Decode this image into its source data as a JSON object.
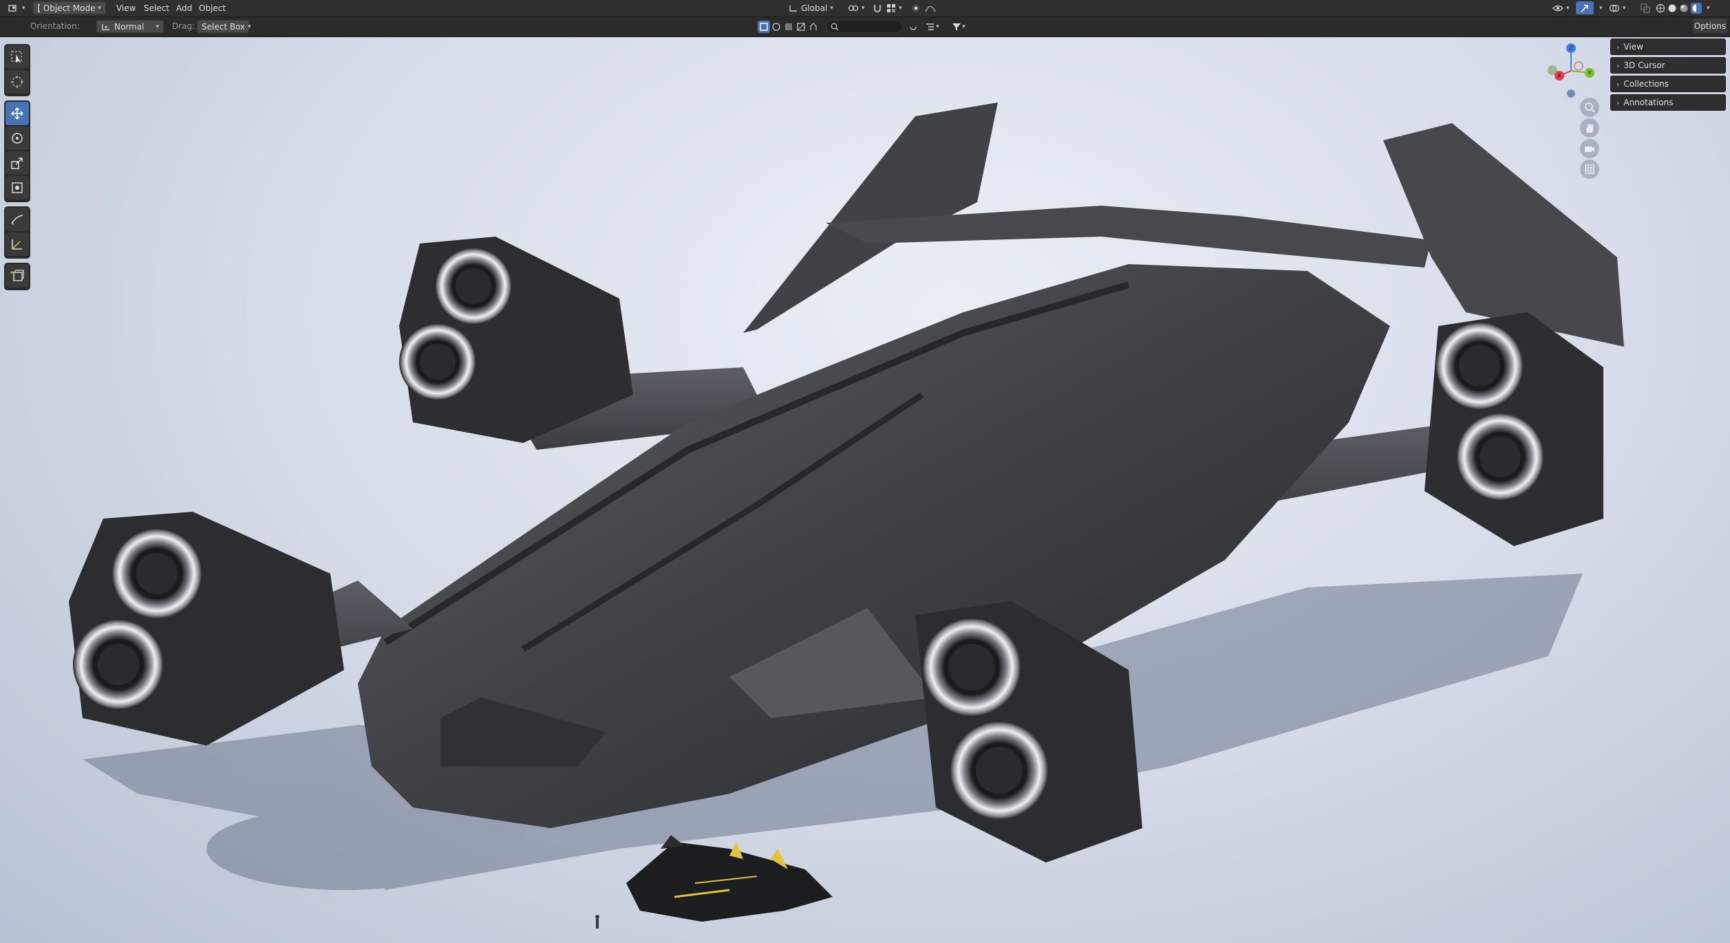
{
  "header": {
    "mode_label": "Object Mode",
    "menus": [
      "View",
      "Select",
      "Add",
      "Object"
    ],
    "transform_orientation": "Global"
  },
  "tool_header": {
    "orientation_label": "Orientation:",
    "orientation_value": "Normal",
    "drag_label": "Drag:",
    "drag_value": "Select Box",
    "search_placeholder": "",
    "options_label": "Options"
  },
  "toolbar": {
    "tools": [
      {
        "name": "select-box-tool",
        "icon": "select-box-icon",
        "active": false
      },
      {
        "name": "cursor-tool",
        "icon": "cursor-icon",
        "active": false
      },
      {
        "name": "move-tool",
        "icon": "move-icon",
        "active": true
      },
      {
        "name": "rotate-tool",
        "icon": "rotate-icon",
        "active": false
      },
      {
        "name": "scale-tool",
        "icon": "scale-icon",
        "active": false
      },
      {
        "name": "transform-tool",
        "icon": "transform-icon",
        "active": false
      },
      {
        "name": "annotate-tool",
        "icon": "annotate-icon",
        "active": false
      },
      {
        "name": "measure-tool",
        "icon": "measure-icon",
        "active": false
      },
      {
        "name": "add-cube-tool",
        "icon": "add-cube-icon",
        "active": false
      }
    ]
  },
  "sidebar": {
    "panels": [
      "View",
      "3D Cursor",
      "Collections",
      "Annotations"
    ]
  },
  "gizmo": {
    "axis_labels": {
      "x": "X",
      "y": "Y",
      "z": "Z"
    },
    "colors": {
      "x": "#e8394a",
      "y": "#7dbd30",
      "z": "#3f7fe6"
    }
  },
  "colors": {
    "active_tool": "#4772b3",
    "header_bg": "#303030"
  }
}
